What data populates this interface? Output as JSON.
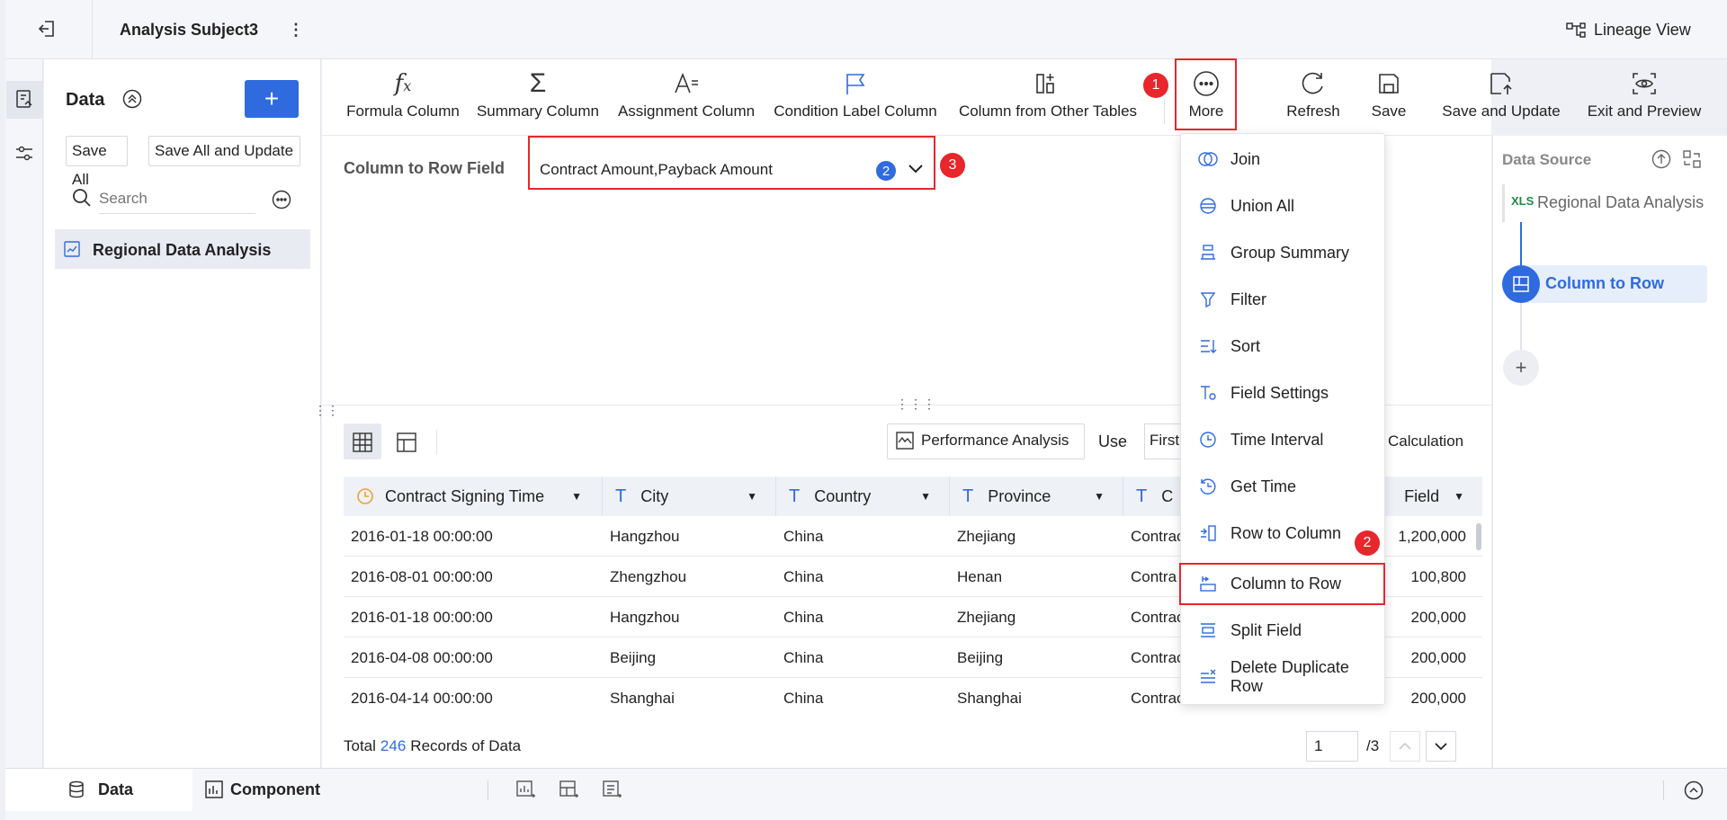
{
  "header": {
    "title": "Analysis Subject3",
    "lineage_label": "Lineage View"
  },
  "toolbar": {
    "items": [
      {
        "label": "Formula Column",
        "icon": "fx-icon"
      },
      {
        "label": "Summary Column",
        "icon": "sigma-icon"
      },
      {
        "label": "Assignment Column",
        "icon": "assign-icon"
      },
      {
        "label": "Condition Label Column",
        "icon": "flag-icon"
      },
      {
        "label": "Column from Other Tables",
        "icon": "columns-add-icon"
      },
      {
        "label": "More",
        "icon": "more-icon"
      },
      {
        "label": "Refresh",
        "icon": "refresh-icon"
      },
      {
        "label": "Save",
        "icon": "save-icon"
      },
      {
        "label": "Save and Update",
        "icon": "save-update-icon"
      },
      {
        "label": "Exit and Preview",
        "icon": "preview-icon"
      }
    ]
  },
  "data_panel": {
    "title": "Data",
    "add_label": "+",
    "save_all": "Save All",
    "save_all_update": "Save All and Update",
    "search_placeholder": "Search",
    "table_item": "Regional Data Analysis"
  },
  "config": {
    "field_label": "Column to Row Field",
    "field_value": "Contract Amount,Payback Amount",
    "field_count": "2"
  },
  "view": {
    "performance_label": "Performance Analysis",
    "use_label": "Use",
    "first_label": "First",
    "calculation_label": "Calculation"
  },
  "table": {
    "columns": [
      "Contract Signing Time",
      "City",
      "Country",
      "Province",
      "C",
      "Field"
    ],
    "rows": [
      [
        "2016-01-18 00:00:00",
        "Hangzhou",
        "China",
        "Zhejiang",
        "Contrac",
        "1,200,000"
      ],
      [
        "2016-08-01 00:00:00",
        "Zhengzhou",
        "China",
        "Henan",
        "Contra",
        "100,800"
      ],
      [
        "2016-01-18 00:00:00",
        "Hangzhou",
        "China",
        "Zhejiang",
        "Contrac",
        "200,000"
      ],
      [
        "2016-04-08 00:00:00",
        "Beijing",
        "China",
        "Beijing",
        "Contrac",
        "200,000"
      ],
      [
        "2016-04-14 00:00:00",
        "Shanghai",
        "China",
        "Shanghai",
        "Contrac",
        "200,000"
      ]
    ]
  },
  "footer": {
    "total_prefix": "Total",
    "total_count": "246",
    "total_suffix": "Records of Data",
    "page": "1",
    "pages": "/3"
  },
  "menu": {
    "items": [
      "Join",
      "Union All",
      "Group Summary",
      "Filter",
      "Sort",
      "Field Settings",
      "Time Interval",
      "Get Time",
      "Row to Column",
      "Column to Row",
      "Split Field",
      "Delete Duplicate Row"
    ]
  },
  "badges": {
    "b1": "1",
    "b2": "2",
    "b3": "3"
  },
  "source": {
    "title": "Data Source",
    "node1": "Regional Data Analysis",
    "node1_tag": "XLS",
    "node2": "Column to Row",
    "add": "+"
  },
  "bottom": {
    "tab_data": "Data",
    "tab_component": "Component"
  },
  "colors": {
    "accent": "#2f6bdf",
    "red": "#e8262c",
    "selected_bg": "#e6eefc"
  }
}
